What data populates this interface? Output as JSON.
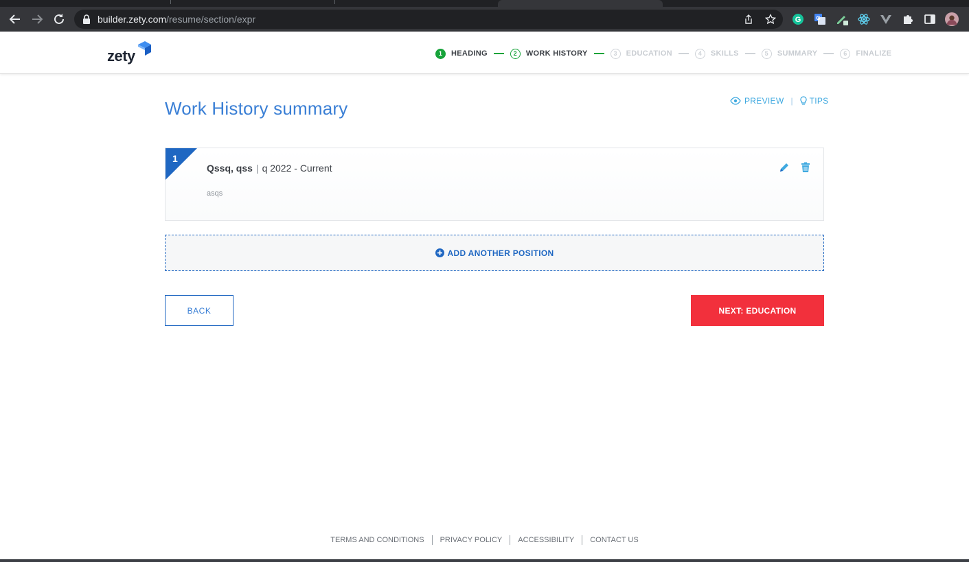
{
  "browser": {
    "url_host": "builder.zety.com",
    "url_path": "/resume/section/expr",
    "extensions": [
      "grammarly-icon",
      "google-translate-icon",
      "pen-extension-icon",
      "react-devtools-icon",
      "vue-devtools-icon",
      "puzzle-icon",
      "sidepanel-icon",
      "profile-avatar"
    ]
  },
  "header": {
    "logo": "zety",
    "steps": [
      {
        "num": "1",
        "label": "HEADING",
        "state": "done"
      },
      {
        "num": "2",
        "label": "WORK HISTORY",
        "state": "current"
      },
      {
        "num": "3",
        "label": "EDUCATION",
        "state": "todo"
      },
      {
        "num": "4",
        "label": "SKILLS",
        "state": "todo"
      },
      {
        "num": "5",
        "label": "SUMMARY",
        "state": "todo"
      },
      {
        "num": "6",
        "label": "FINALIZE",
        "state": "todo"
      }
    ]
  },
  "main": {
    "title": "Work History summary",
    "preview_label": "PREVIEW",
    "tips_label": "TIPS",
    "entries": [
      {
        "index": "1",
        "employer": "Qssq, qss",
        "dates": "q 2022 - Current",
        "description": "asqs"
      }
    ],
    "add_position_label": "ADD ANOTHER POSITION",
    "back_label": "BACK",
    "next_label": "NEXT: EDUCATION"
  },
  "footer": {
    "links": [
      "TERMS AND CONDITIONS",
      "PRIVACY POLICY",
      "ACCESSIBILITY",
      "CONTACT US"
    ]
  },
  "colors": {
    "brand_blue": "#1f67c2",
    "title_blue": "#3a7fd5",
    "step_green": "#17a33a",
    "cta_red": "#f2303c"
  }
}
